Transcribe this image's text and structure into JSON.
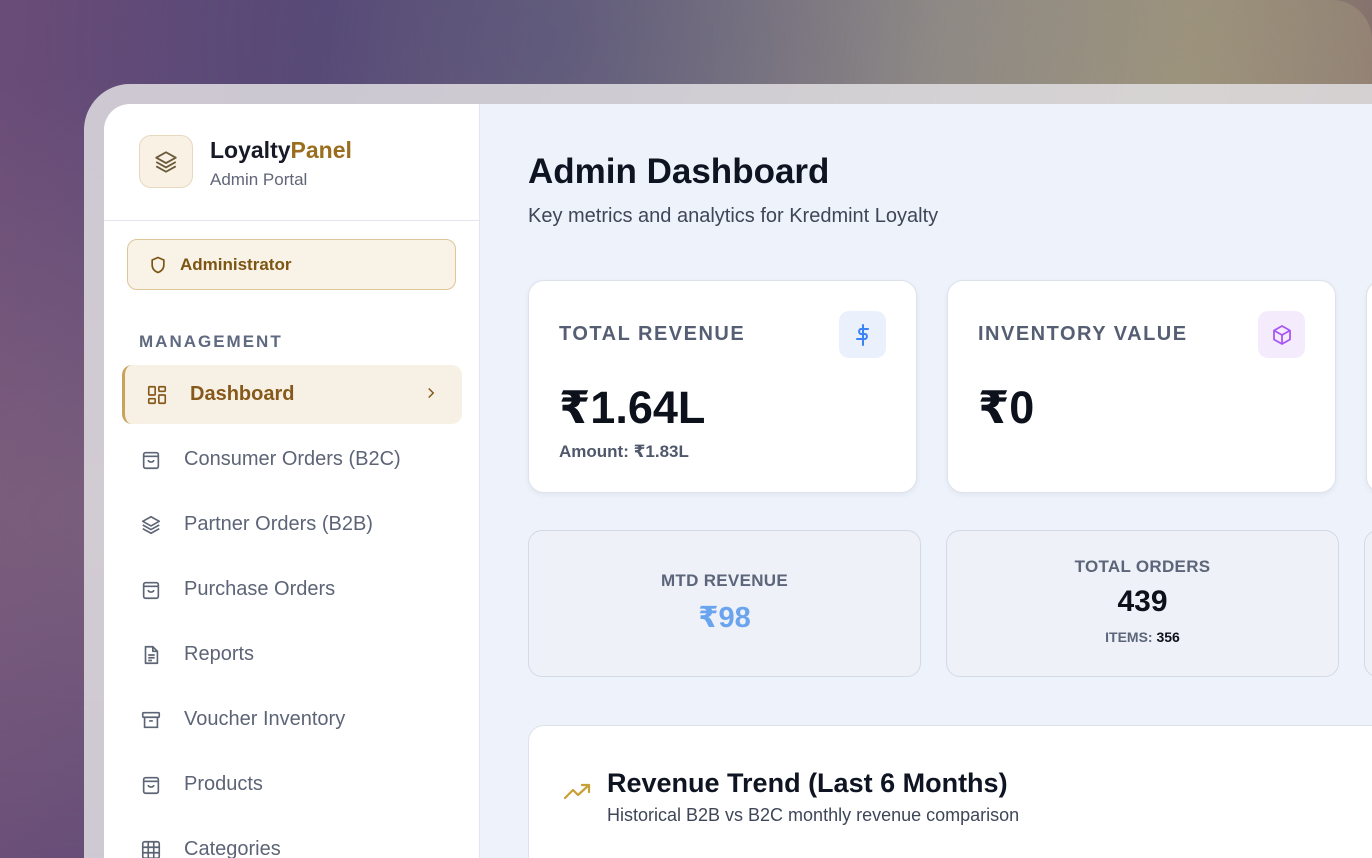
{
  "brand": {
    "name_part1": "Loyalty",
    "name_part2": "Panel",
    "subtitle": "Admin Portal",
    "accent_color": "#9b6e1f"
  },
  "role": {
    "label": "Administrator"
  },
  "sidebar": {
    "section_label": "MANAGEMENT",
    "items": [
      {
        "label": "Dashboard",
        "icon": "dashboard-grid-icon",
        "active": true
      },
      {
        "label": "Consumer Orders (B2C)",
        "icon": "shopping-bag-icon"
      },
      {
        "label": "Partner Orders (B2B)",
        "icon": "layers-icon"
      },
      {
        "label": "Purchase Orders",
        "icon": "shopping-bag-icon"
      },
      {
        "label": "Reports",
        "icon": "document-icon"
      },
      {
        "label": "Voucher Inventory",
        "icon": "archive-box-icon"
      },
      {
        "label": "Products",
        "icon": "shopping-bag-icon"
      },
      {
        "label": "Categories",
        "icon": "grid-table-icon"
      }
    ]
  },
  "header": {
    "title": "Admin Dashboard",
    "subtitle": "Key metrics and analytics for Kredmint Loyalty"
  },
  "cards": {
    "total_revenue": {
      "label": "TOTAL REVENUE",
      "value": "₹1.64L",
      "note": "Amount: ₹1.83L",
      "icon": "dollar-icon",
      "icon_color": "#3b82f6"
    },
    "inventory_value": {
      "label": "INVENTORY VALUE",
      "value": "₹0",
      "icon": "cube-icon",
      "icon_color": "#a855f7"
    }
  },
  "mini_cards": {
    "mtd_revenue": {
      "label": "MTD REVENUE",
      "value": "₹98",
      "value_color": "#6aa3ee"
    },
    "total_orders": {
      "label": "TOTAL ORDERS",
      "value": "439",
      "items_label": "ITEMS:",
      "items_value": "356"
    }
  },
  "trend": {
    "title": "Revenue Trend (Last 6 Months)",
    "subtitle": "Historical B2B vs B2C monthly revenue comparison",
    "icon": "trending-up-icon"
  }
}
